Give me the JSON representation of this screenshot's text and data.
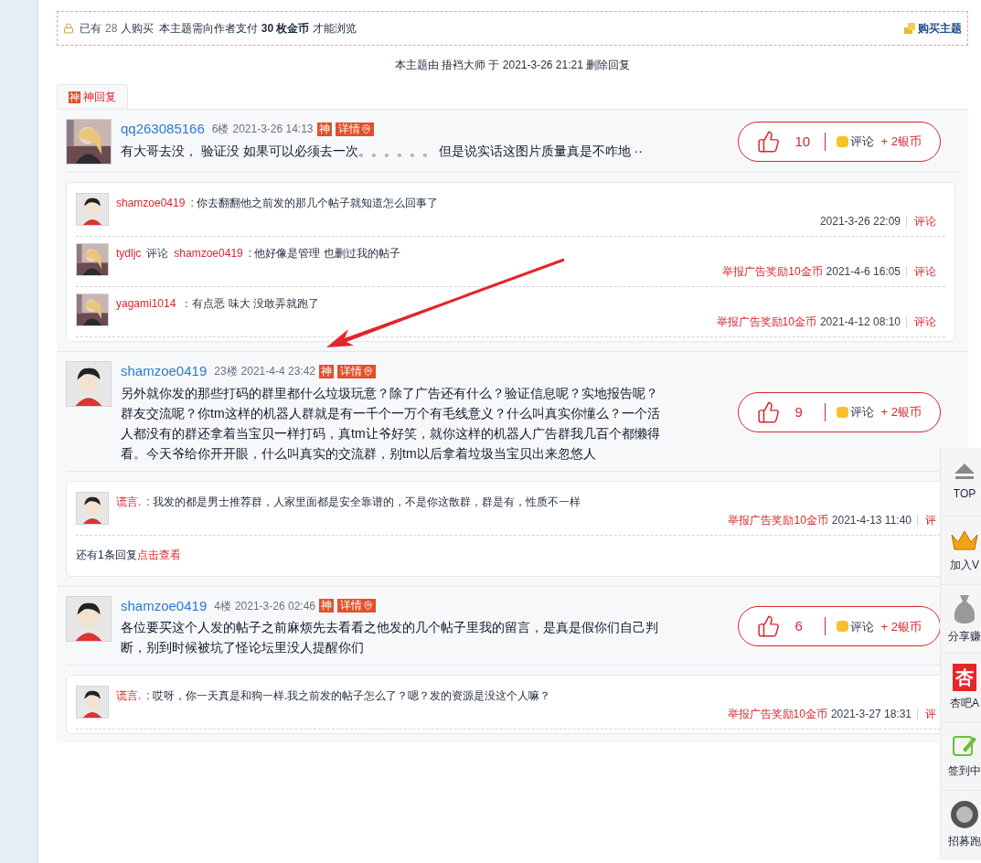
{
  "purchase_notice": {
    "buyers_prefix": "已有",
    "buyers": "28",
    "buyers_suffix": "人购买",
    "requirement": "本主题需向作者支付 **30 枚金币** 才能浏览",
    "buy_button": "购买主题"
  },
  "moderation_note": "本主题由 捂裆大师 于 2021-3-26 21:21 删除回复",
  "tab": {
    "mark": "神",
    "label": "神回复"
  },
  "posts": [
    {
      "author": "qq263085166",
      "floor": "6楼",
      "time": "2021-3-26 14:13",
      "badge": "神",
      "detail": "详情",
      "body": "有大哥去没， 验证没 如果可以必须去一次。。。。。。 但是说实话这图片质量真是不咋地 ··",
      "likes": "10",
      "comment": "评论",
      "reward": "+ 2银币",
      "comments": [
        {
          "avatar": {
            "kind": "cartoon"
          },
          "author": "shamzoe0419",
          "text": ": 你去翻翻他之前发的那几个帖子就知道怎么回事了",
          "time": "2021-3-26 22:09",
          "action": "评论"
        },
        {
          "author": "tydljc",
          "reply_word": "评论",
          "reply_to": "shamzoe0419",
          "text": ": 他好像是管理 也删过我的帖子",
          "report": "举报广告奖励10金币",
          "time": "2021-4-6 16:05",
          "action": "评论"
        },
        {
          "author": "yagami1014",
          "text": "：有点恶 味大 没敢弄就跑了",
          "report": "举报广告奖励10金币",
          "time": "2021-4-12 08:10",
          "action": "评论"
        }
      ]
    },
    {
      "avatar": {
        "kind": "cartoon"
      },
      "author": "shamzoe0419",
      "floor": "23楼",
      "time": "2021-4-4 23:42",
      "badge": "神",
      "detail": "详情",
      "body": "另外就你发的那些打码的群里都什么垃圾玩意？除了广告还有什么？验证信息呢？实地报告呢？群友交流呢？你tm这样的机器人群就是有一千个一万个有毛线意义？什么叫真实你懂么？一个活人都没有的群还拿着当宝贝一样打码，真tm让爷好笑，就你这样的机器人广告群我几百个都懒得看。今天爷给你开开眼，什么叫真实的交流群，别tm以后拿着垃圾当宝贝出来忽悠人",
      "likes": "9",
      "comment": "评论",
      "reward": "+ 2银币",
      "comments": [
        {
          "avatar": {
            "kind": "cartoon"
          },
          "author": "谎言.",
          "text": ": 我发的都是男士推荐群，人家里面都是安全靠谱的，不是你这散群，群是有，性质不一样",
          "report": "举报广告奖励10金币",
          "time": "2021-4-13 11:40",
          "action": "评"
        }
      ],
      "more": {
        "text": "还有1条回复",
        "link": "点击查看"
      }
    },
    {
      "avatar": {
        "kind": "cartoon"
      },
      "author": "shamzoe0419",
      "floor": "4楼",
      "time": "2021-3-26 02:46",
      "badge": "神",
      "detail": "详情",
      "body": "各位要买这个人发的帖子之前麻烦先去看看之他发的几个帖子里我的留言，是真是假你们自己判断，别到时候被坑了怪论坛里没人提醒你们",
      "likes": "6",
      "comment": "评论",
      "reward": "+ 2银币",
      "comments": [
        {
          "avatar": {
            "kind": "cartoon"
          },
          "author": "谎言.",
          "text": ": 哎呀，你一天真是和狗一样.我之前发的帖子怎么了？嗯？发的资源是没这个人嘛？",
          "report": "举报广告奖励10金币",
          "time": "2021-3-27 18:31",
          "action": "评"
        }
      ]
    }
  ],
  "side_tools": [
    {
      "kind": "top",
      "label": "TOP"
    },
    {
      "kind": "crown",
      "label": "加入V"
    },
    {
      "kind": "bag",
      "label": "分享赚"
    },
    {
      "kind": "logo",
      "logo": "杏",
      "label": "杏吧A"
    },
    {
      "kind": "pencil",
      "label": "签到中"
    },
    {
      "kind": "coin",
      "label": "招募跑"
    }
  ]
}
